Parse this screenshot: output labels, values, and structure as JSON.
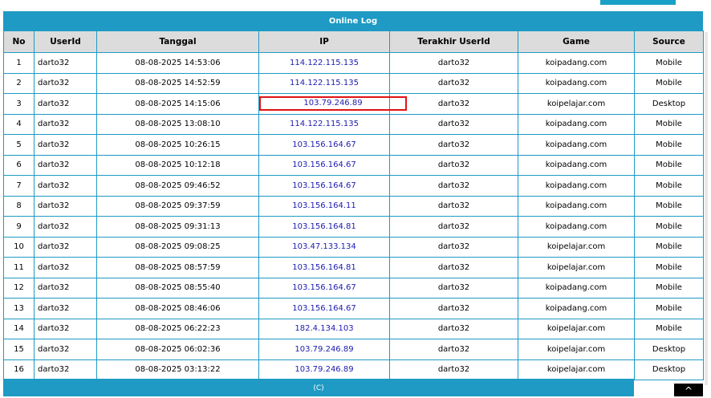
{
  "panel": {
    "title": "Online Log"
  },
  "columns": [
    "No",
    "UserId",
    "Tanggal",
    "IP",
    "Terakhir UserId",
    "Game",
    "Source"
  ],
  "rows": [
    {
      "no": "1",
      "uid": "darto32",
      "date": "08-08-2025 14:53:06",
      "ip": "114.122.115.135",
      "last": "darto32",
      "game": "koipadang.com",
      "source": "Mobile"
    },
    {
      "no": "2",
      "uid": "darto32",
      "date": "08-08-2025 14:52:59",
      "ip": "114.122.115.135",
      "last": "darto32",
      "game": "koipadang.com",
      "source": "Mobile"
    },
    {
      "no": "3",
      "uid": "darto32",
      "date": "08-08-2025 14:15:06",
      "ip": "103.79.246.89",
      "last": "darto32",
      "game": "koipelajar.com",
      "source": "Desktop"
    },
    {
      "no": "4",
      "uid": "darto32",
      "date": "08-08-2025 13:08:10",
      "ip": "114.122.115.135",
      "last": "darto32",
      "game": "koipadang.com",
      "source": "Mobile"
    },
    {
      "no": "5",
      "uid": "darto32",
      "date": "08-08-2025 10:26:15",
      "ip": "103.156.164.67",
      "last": "darto32",
      "game": "koipadang.com",
      "source": "Mobile"
    },
    {
      "no": "6",
      "uid": "darto32",
      "date": "08-08-2025 10:12:18",
      "ip": "103.156.164.67",
      "last": "darto32",
      "game": "koipadang.com",
      "source": "Mobile"
    },
    {
      "no": "7",
      "uid": "darto32",
      "date": "08-08-2025 09:46:52",
      "ip": "103.156.164.67",
      "last": "darto32",
      "game": "koipadang.com",
      "source": "Mobile"
    },
    {
      "no": "8",
      "uid": "darto32",
      "date": "08-08-2025 09:37:59",
      "ip": "103.156.164.11",
      "last": "darto32",
      "game": "koipadang.com",
      "source": "Mobile"
    },
    {
      "no": "9",
      "uid": "darto32",
      "date": "08-08-2025 09:31:13",
      "ip": "103.156.164.81",
      "last": "darto32",
      "game": "koipadang.com",
      "source": "Mobile"
    },
    {
      "no": "10",
      "uid": "darto32",
      "date": "08-08-2025 09:08:25",
      "ip": "103.47.133.134",
      "last": "darto32",
      "game": "koipelajar.com",
      "source": "Mobile"
    },
    {
      "no": "11",
      "uid": "darto32",
      "date": "08-08-2025 08:57:59",
      "ip": "103.156.164.81",
      "last": "darto32",
      "game": "koipelajar.com",
      "source": "Mobile"
    },
    {
      "no": "12",
      "uid": "darto32",
      "date": "08-08-2025 08:55:40",
      "ip": "103.156.164.67",
      "last": "darto32",
      "game": "koipadang.com",
      "source": "Mobile"
    },
    {
      "no": "13",
      "uid": "darto32",
      "date": "08-08-2025 08:46:06",
      "ip": "103.156.164.67",
      "last": "darto32",
      "game": "koipadang.com",
      "source": "Mobile"
    },
    {
      "no": "14",
      "uid": "darto32",
      "date": "08-08-2025 06:22:23",
      "ip": "182.4.134.103",
      "last": "darto32",
      "game": "koipelajar.com",
      "source": "Mobile"
    },
    {
      "no": "15",
      "uid": "darto32",
      "date": "08-08-2025 06:02:36",
      "ip": "103.79.246.89",
      "last": "darto32",
      "game": "koipelajar.com",
      "source": "Desktop"
    },
    {
      "no": "16",
      "uid": "darto32",
      "date": "08-08-2025 03:13:22",
      "ip": "103.79.246.89",
      "last": "darto32",
      "game": "koipelajar.com",
      "source": "Desktop"
    }
  ],
  "highlight_row": 2,
  "footer": {
    "text": "(C)"
  },
  "scroll_top": {
    "icon": "chevron-up-icon",
    "glyph": "^"
  },
  "colors": {
    "accent": "#1e9ac4",
    "ip_text": "#1b1bb0",
    "highlight": "#e01414",
    "header_bg": "#dcdcdc"
  }
}
